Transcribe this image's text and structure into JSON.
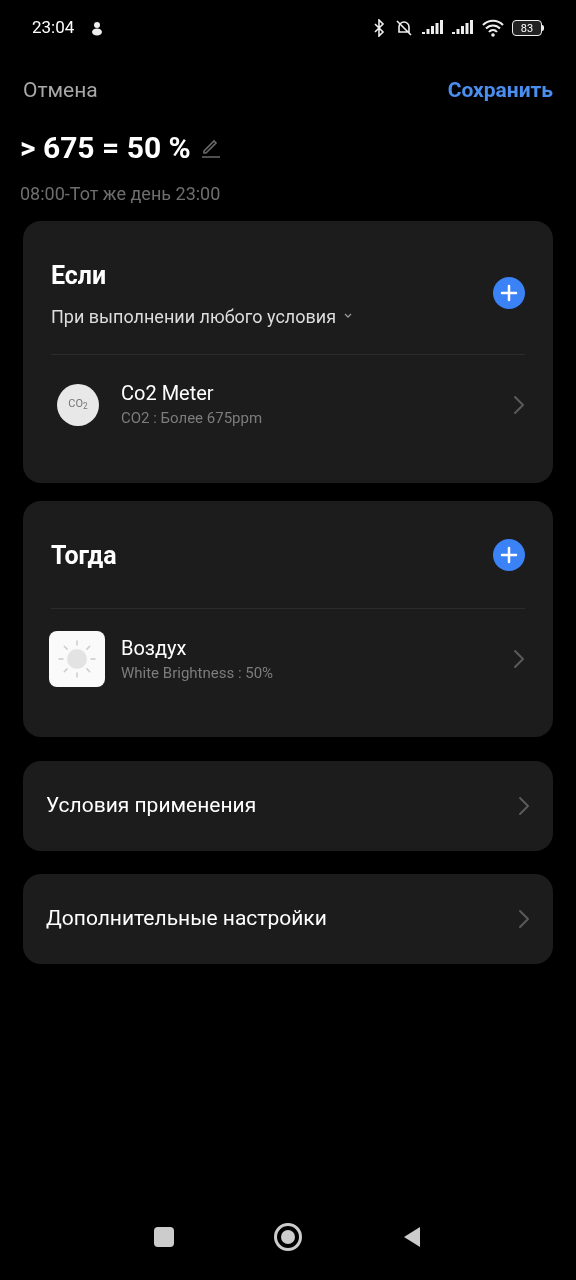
{
  "status_bar": {
    "time": "23:04",
    "battery": "83"
  },
  "header": {
    "cancel": "Отмена",
    "save": "Сохранить"
  },
  "scene": {
    "title": "> 675 = 50 %",
    "schedule": "08:00-Тот же день 23:00"
  },
  "if_card": {
    "title": "Если",
    "mode": "При выполнении любого условия",
    "items": [
      {
        "kind": "sensor",
        "name": "Co2 Meter",
        "detail": "CO2 : Более 675ppm",
        "badge": "CO$_{2}$"
      }
    ]
  },
  "then_card": {
    "title": "Тогда",
    "items": [
      {
        "kind": "lamp",
        "name": "Воздух",
        "detail": "White Brightness : 50%"
      }
    ]
  },
  "links": [
    "Условия применения",
    "Дополнительные настройки"
  ]
}
